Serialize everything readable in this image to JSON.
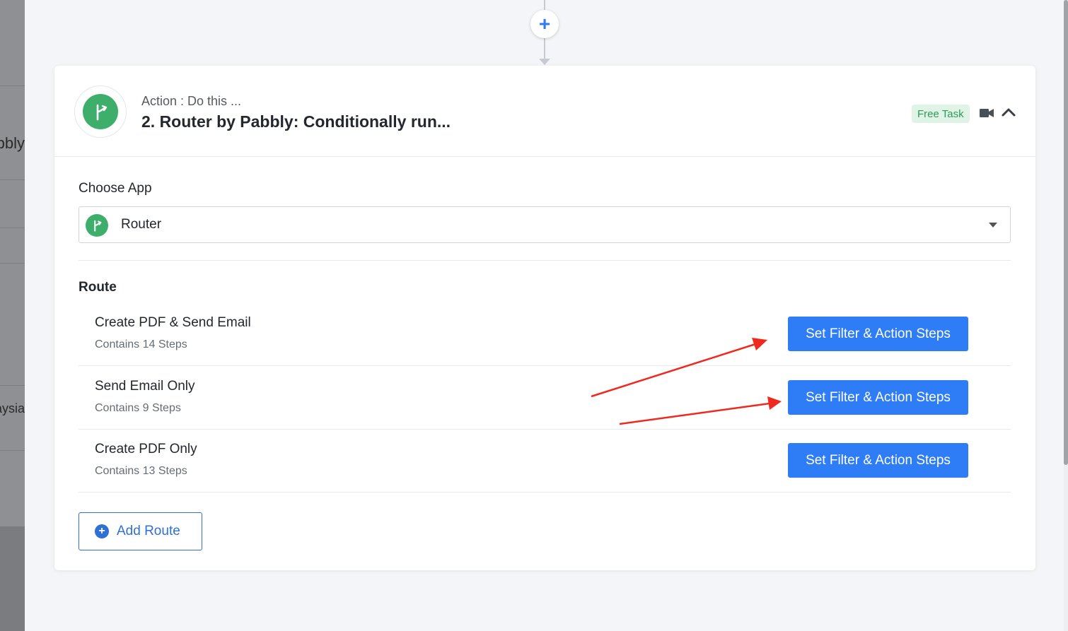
{
  "background": {
    "left_labels": [
      "bbly",
      "aysia"
    ]
  },
  "connector": {
    "add_icon": "plus-icon"
  },
  "card": {
    "step_type": "Action : Do this ...",
    "title": "2. Router by Pabbly: Conditionally run...",
    "badge": "Free Task",
    "icons": [
      "router-icon",
      "video-icon",
      "chevron-up-icon"
    ]
  },
  "choose_app": {
    "label": "Choose App",
    "selected": "Router"
  },
  "route": {
    "label": "Route",
    "items": [
      {
        "name": "Create PDF & Send Email",
        "steps": "Contains 14 Steps",
        "button": "Set Filter & Action Steps"
      },
      {
        "name": "Send Email Only",
        "steps": "Contains 9 Steps",
        "button": "Set Filter & Action Steps"
      },
      {
        "name": "Create PDF Only",
        "steps": "Contains 13 Steps",
        "button": "Set Filter & Action Steps"
      }
    ],
    "add_button": "Add Route"
  },
  "colors": {
    "accent": "#2f7df6",
    "router_green": "#3eaf6b",
    "annotation_red": "#f0291f"
  }
}
